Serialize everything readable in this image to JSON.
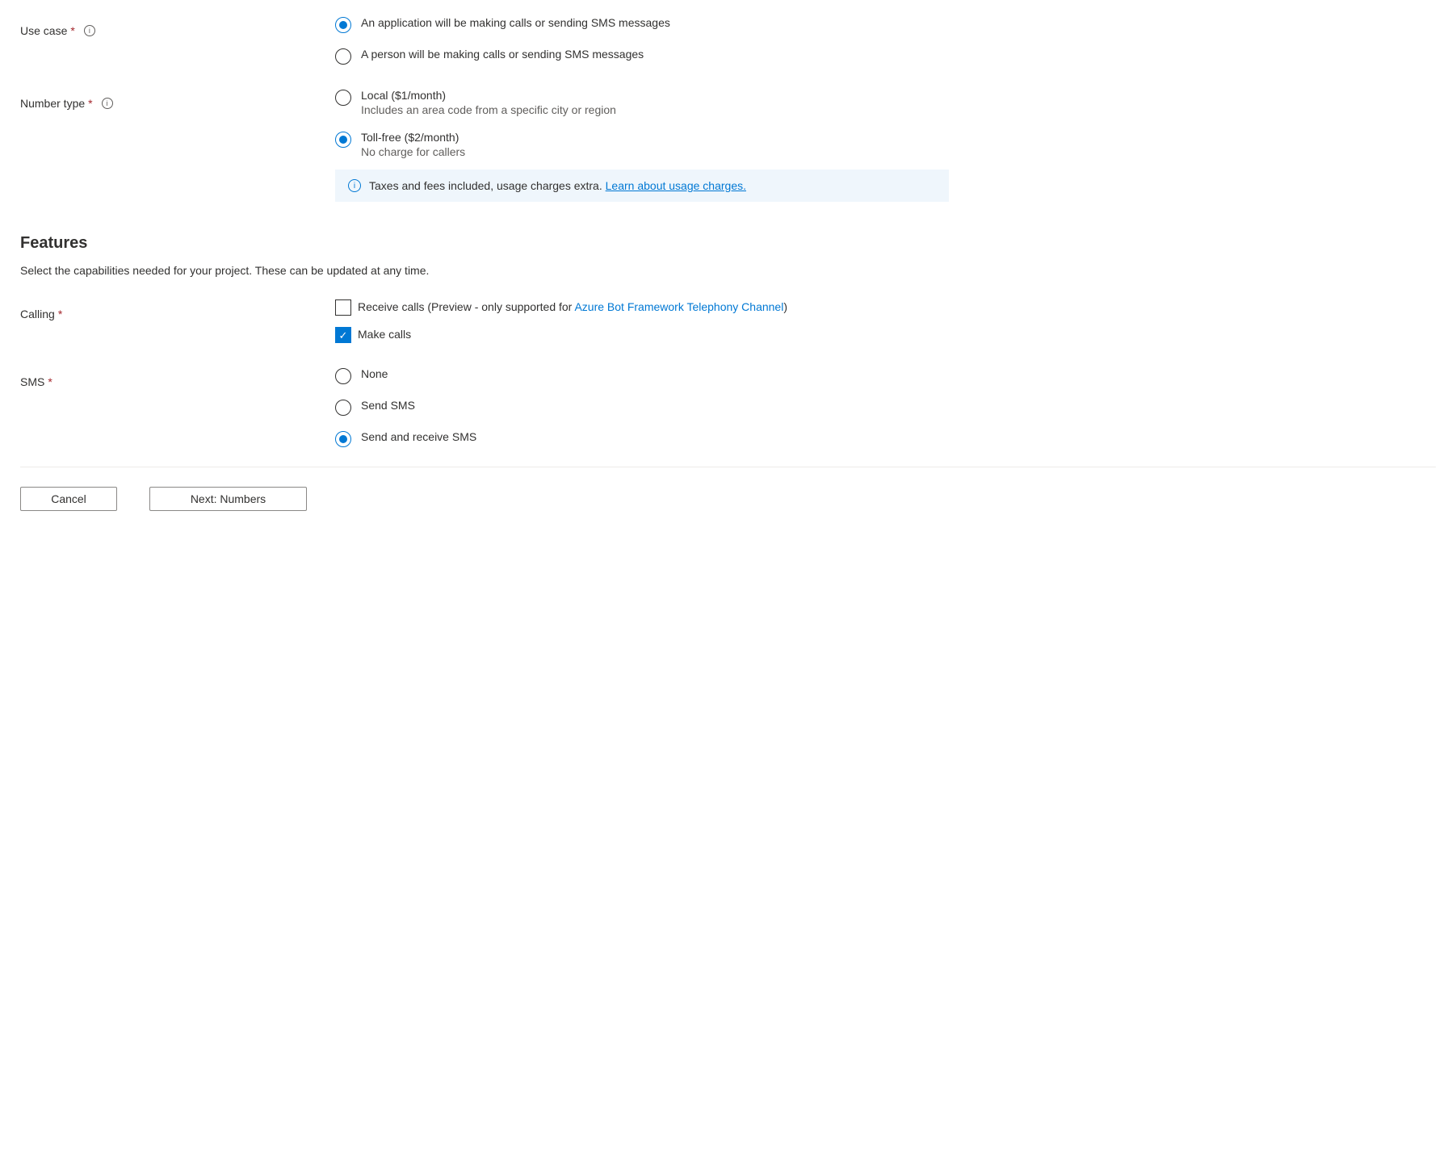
{
  "useCase": {
    "label": "Use case",
    "options": {
      "application": "An application will be making calls or sending SMS messages",
      "person": "A person will be making calls or sending SMS messages"
    }
  },
  "numberType": {
    "label": "Number type",
    "local": {
      "title": "Local ($1/month)",
      "subtitle": "Includes an area code from a specific city or region"
    },
    "tollfree": {
      "title": "Toll-free ($2/month)",
      "subtitle": "No charge for callers"
    }
  },
  "infoBox": {
    "text": "Taxes and fees included, usage charges extra. ",
    "linkText": "Learn about usage charges."
  },
  "features": {
    "heading": "Features",
    "description": "Select the capabilities needed for your project. These can be updated at any time."
  },
  "calling": {
    "label": "Calling",
    "receive": {
      "prefix": "Receive calls (Preview - only supported for ",
      "link": "Azure Bot Framework Telephony Channel",
      "suffix": ")"
    },
    "make": "Make calls"
  },
  "sms": {
    "label": "SMS",
    "none": "None",
    "send": "Send SMS",
    "sendReceive": "Send and receive SMS"
  },
  "buttons": {
    "cancel": "Cancel",
    "next": "Next: Numbers"
  }
}
